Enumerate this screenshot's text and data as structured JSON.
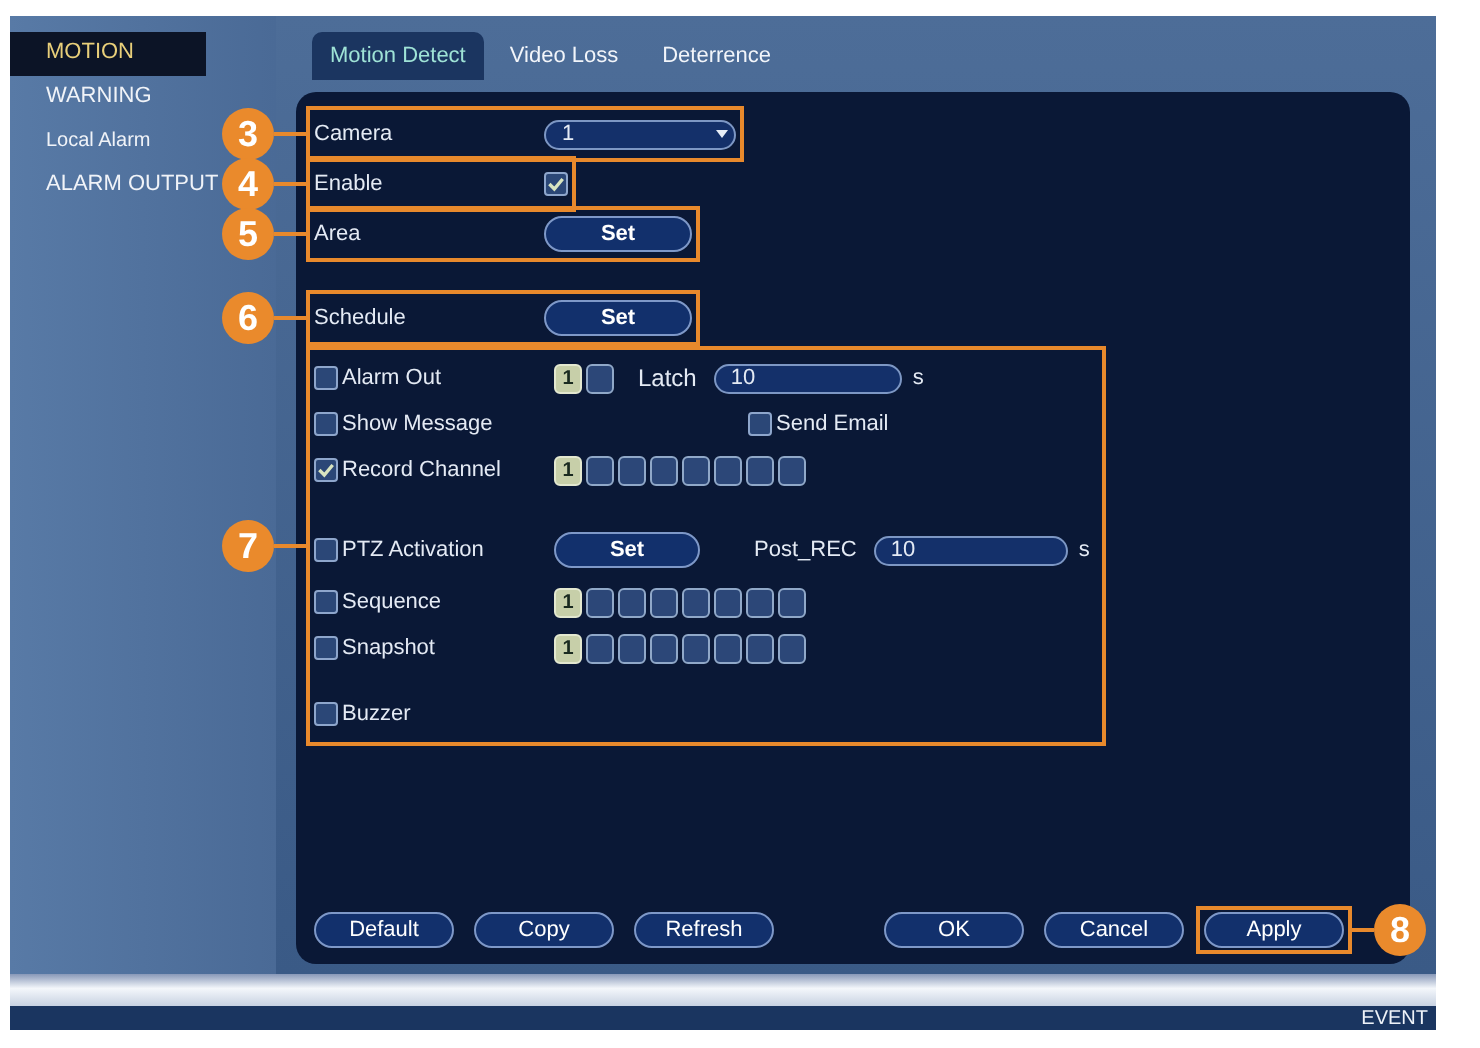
{
  "sidebar": {
    "items": [
      {
        "label": "MOTION",
        "selected": true
      },
      {
        "label": "WARNING",
        "selected": false
      },
      {
        "label": "Local Alarm",
        "selected": false
      },
      {
        "label": "ALARM OUTPUT",
        "selected": false
      }
    ]
  },
  "tabs": [
    {
      "label": "Motion Detect",
      "selected": true
    },
    {
      "label": "Video Loss",
      "selected": false
    },
    {
      "label": "Deterrence",
      "selected": false
    }
  ],
  "settings": [
    {
      "kind": "select",
      "label": "Camera",
      "value": "1",
      "callout": "3"
    },
    {
      "kind": "checkbox",
      "label": "Enable",
      "checked": true,
      "callout": "4"
    },
    {
      "kind": "button",
      "label": "Area",
      "button": "Set",
      "callout": "5"
    },
    {
      "kind": "button",
      "label": "Schedule",
      "button": "Set",
      "callout": "6"
    }
  ],
  "actions": {
    "callout": "7",
    "rows": [
      {
        "kind": "latch",
        "label": "Alarm Out",
        "checked": false,
        "channels": [
          {
            "label": "1",
            "selected": true
          },
          {
            "selected": false
          }
        ],
        "extra_label": "Latch",
        "extra_value": "10",
        "unit": "s"
      },
      {
        "kind": "pair",
        "label": "Show Message",
        "checked": false,
        "second": {
          "label": "Send Email",
          "checked": false
        }
      },
      {
        "kind": "channels",
        "label": "Record Channel",
        "checked": true,
        "channels": [
          {
            "label": "1",
            "selected": true
          },
          {
            "selected": false
          },
          {
            "selected": false
          },
          {
            "selected": false
          },
          {
            "selected": false
          },
          {
            "selected": false
          },
          {
            "selected": false
          },
          {
            "selected": false
          }
        ]
      },
      {
        "kind": "ptz",
        "label": "PTZ Activation",
        "checked": false,
        "button": "Set",
        "extra_label": "Post_REC",
        "extra_value": "10",
        "unit": "s"
      },
      {
        "kind": "channels",
        "label": "Sequence",
        "checked": false,
        "channels": [
          {
            "label": "1",
            "selected": true
          },
          {
            "selected": false
          },
          {
            "selected": false
          },
          {
            "selected": false
          },
          {
            "selected": false
          },
          {
            "selected": false
          },
          {
            "selected": false
          },
          {
            "selected": false
          }
        ]
      },
      {
        "kind": "channels",
        "label": "Snapshot",
        "checked": false,
        "channels": [
          {
            "label": "1",
            "selected": true
          },
          {
            "selected": false
          },
          {
            "selected": false
          },
          {
            "selected": false
          },
          {
            "selected": false
          },
          {
            "selected": false
          },
          {
            "selected": false
          },
          {
            "selected": false
          }
        ]
      },
      {
        "kind": "plain",
        "label": "Buzzer",
        "checked": false
      }
    ]
  },
  "buttons": {
    "left": [
      {
        "label": "Default"
      },
      {
        "label": "Copy"
      },
      {
        "label": "Refresh"
      }
    ],
    "right": [
      {
        "label": "OK"
      },
      {
        "label": "Cancel"
      },
      {
        "label": "Apply",
        "callout": "8"
      }
    ]
  },
  "footer": {
    "title": "EVENT"
  }
}
